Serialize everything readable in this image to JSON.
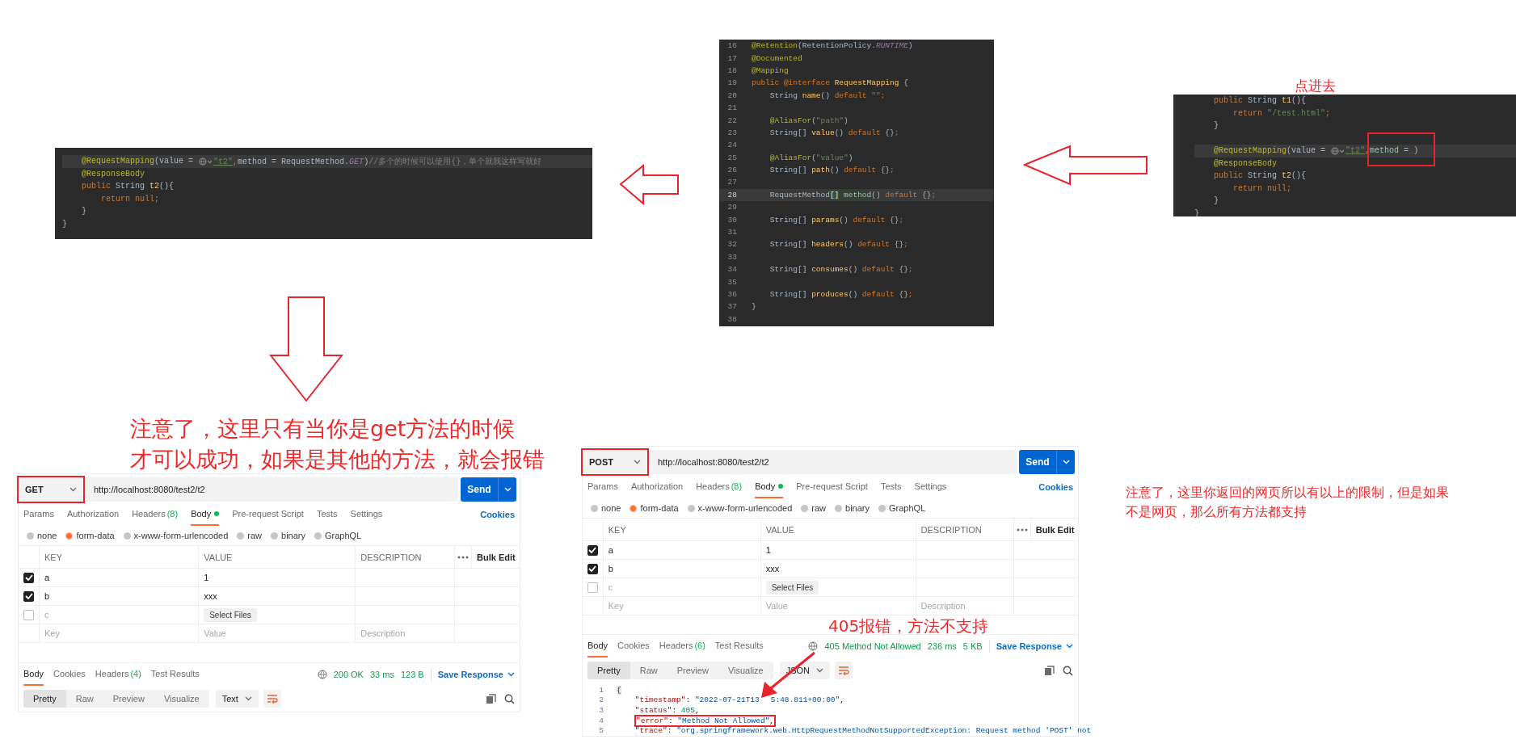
{
  "annotations": [
    {
      "text": "点进去"
    },
    {
      "text": "注意了，这里只有当你是get方法的时候"
    },
    {
      "text": "才可以成功，如果是其他的方法，就会报错"
    },
    {
      "text": "405报错，方法不支持"
    },
    {
      "text": "注意了，这里你返回的网页所以有以上的限制，但是如果"
    },
    {
      "text": "不是网页，那么所有方法都支持"
    }
  ],
  "code_snippets": [
    {
      "lines": [
        {
          "current": true,
          "tokens": [
            {
              "t": "    @RequestMapping",
              "kind": "ann"
            },
            {
              "t": "(value = ",
              "kind": "p"
            },
            {
              "kind": "inlay"
            },
            {
              "t": "\"t2\"",
              "kind": "link"
            },
            {
              "t": ",",
              "kind": "kw"
            },
            {
              "t": "method = RequestMethod.",
              "kind": "p"
            },
            {
              "t": "GET",
              "kind": "const"
            },
            {
              "t": ")",
              "kind": "p"
            },
            {
              "t": "//多个的时候可以使用{}，单个就我这样写就好",
              "kind": "comment"
            }
          ]
        },
        {
          "current": false,
          "tokens": [
            {
              "t": "    @ResponseBody",
              "kind": "ann"
            }
          ]
        },
        {
          "current": false,
          "tokens": [
            {
              "t": "    public ",
              "kind": "kw"
            },
            {
              "t": "String ",
              "kind": "p"
            },
            {
              "t": "t2",
              "kind": "fn"
            },
            {
              "t": "(){",
              "kind": "p"
            }
          ]
        },
        {
          "current": false,
          "tokens": [
            {
              "t": "        return null;",
              "kind": "kw"
            }
          ]
        },
        {
          "current": false,
          "tokens": [
            {
              "t": "    }",
              "kind": "p"
            }
          ]
        },
        {
          "current": false,
          "tokens": [
            {
              "t": "}",
              "kind": "p"
            }
          ]
        }
      ]
    },
    {
      "lines": [
        {
          "num": "16",
          "current": false,
          "tokens": [
            {
              "t": "@Retention",
              "kind": "ann"
            },
            {
              "t": "(RetentionPolicy.",
              "kind": "p"
            },
            {
              "t": "RUNTIME",
              "kind": "const"
            },
            {
              "t": ")",
              "kind": "p"
            }
          ]
        },
        {
          "num": "17",
          "current": false,
          "tokens": [
            {
              "t": "@Documented",
              "kind": "ann"
            }
          ]
        },
        {
          "num": "18",
          "current": false,
          "tokens": [
            {
              "t": "@Mapping",
              "kind": "ann"
            }
          ]
        },
        {
          "num": "19",
          "current": false,
          "tokens": [
            {
              "t": "public @interface ",
              "kind": "kw"
            },
            {
              "t": "RequestMapping ",
              "kind": "fn"
            },
            {
              "t": "{",
              "kind": "p"
            }
          ]
        },
        {
          "num": "20",
          "current": false,
          "tokens": [
            {
              "t": "    String ",
              "kind": "p"
            },
            {
              "t": "name",
              "kind": "fn"
            },
            {
              "t": "() ",
              "kind": "p"
            },
            {
              "t": "default ",
              "kind": "kw"
            },
            {
              "t": "\"\"",
              "kind": "str"
            },
            {
              "t": ";",
              "kind": "kw"
            }
          ]
        },
        {
          "num": "21",
          "current": false
        },
        {
          "num": "22",
          "current": false,
          "tokens": [
            {
              "t": "    @AliasFor",
              "kind": "ann"
            },
            {
              "t": "(",
              "kind": "p"
            },
            {
              "t": "\"path\"",
              "kind": "str"
            },
            {
              "t": ")",
              "kind": "p"
            }
          ]
        },
        {
          "num": "23",
          "current": false,
          "tokens": [
            {
              "t": "    String[] ",
              "kind": "p"
            },
            {
              "t": "value",
              "kind": "fn"
            },
            {
              "t": "() ",
              "kind": "p"
            },
            {
              "t": "default ",
              "kind": "kw"
            },
            {
              "t": "{}",
              "kind": "p"
            },
            {
              "t": ";",
              "kind": "kw"
            }
          ]
        },
        {
          "num": "24",
          "current": false
        },
        {
          "num": "25",
          "current": false,
          "tokens": [
            {
              "t": "    @AliasFor",
              "kind": "ann"
            },
            {
              "t": "(",
              "kind": "p"
            },
            {
              "t": "\"value\"",
              "kind": "str"
            },
            {
              "t": ")",
              "kind": "p"
            }
          ]
        },
        {
          "num": "26",
          "current": false,
          "tokens": [
            {
              "t": "    String[] ",
              "kind": "p"
            },
            {
              "t": "path",
              "kind": "fn"
            },
            {
              "t": "() ",
              "kind": "p"
            },
            {
              "t": "default ",
              "kind": "kw"
            },
            {
              "t": "{}",
              "kind": "p"
            },
            {
              "t": ";",
              "kind": "kw"
            }
          ]
        },
        {
          "num": "27",
          "current": false
        },
        {
          "num": "28",
          "current": true,
          "tokens": [
            {
              "t": "    RequestMethod",
              "kind": "p"
            },
            {
              "t": "[]",
              "kind": "match"
            },
            {
              "t": " method",
              "kind": "usage"
            },
            {
              "t": "() ",
              "kind": "p"
            },
            {
              "t": "default ",
              "kind": "kw"
            },
            {
              "t": "{}",
              "kind": "p"
            },
            {
              "t": ";",
              "kind": "kw"
            }
          ]
        },
        {
          "num": "29",
          "current": false
        },
        {
          "num": "30",
          "current": false,
          "tokens": [
            {
              "t": "    String[] ",
              "kind": "p"
            },
            {
              "t": "params",
              "kind": "fn"
            },
            {
              "t": "() ",
              "kind": "p"
            },
            {
              "t": "default ",
              "kind": "kw"
            },
            {
              "t": "{}",
              "kind": "p"
            },
            {
              "t": ";",
              "kind": "kw"
            }
          ]
        },
        {
          "num": "31",
          "current": false
        },
        {
          "num": "32",
          "current": false,
          "tokens": [
            {
              "t": "    String[] ",
              "kind": "p"
            },
            {
              "t": "headers",
              "kind": "fn"
            },
            {
              "t": "() ",
              "kind": "p"
            },
            {
              "t": "default ",
              "kind": "kw"
            },
            {
              "t": "{}",
              "kind": "p"
            },
            {
              "t": ";",
              "kind": "kw"
            }
          ]
        },
        {
          "num": "33",
          "current": false
        },
        {
          "num": "34",
          "current": false,
          "tokens": [
            {
              "t": "    String[] ",
              "kind": "p"
            },
            {
              "t": "consumes",
              "kind": "fn"
            },
            {
              "t": "() ",
              "kind": "p"
            },
            {
              "t": "default ",
              "kind": "kw"
            },
            {
              "t": "{}",
              "kind": "p"
            },
            {
              "t": ";",
              "kind": "kw"
            }
          ]
        },
        {
          "num": "35",
          "current": false
        },
        {
          "num": "36",
          "current": false,
          "tokens": [
            {
              "t": "    String[] ",
              "kind": "p"
            },
            {
              "t": "produces",
              "kind": "fn"
            },
            {
              "t": "() ",
              "kind": "p"
            },
            {
              "t": "default ",
              "kind": "kw"
            },
            {
              "t": "{}",
              "kind": "p"
            },
            {
              "t": ";",
              "kind": "kw"
            }
          ]
        },
        {
          "num": "37",
          "current": false,
          "tokens": [
            {
              "t": "}",
              "kind": "p"
            }
          ]
        },
        {
          "num": "38",
          "current": false
        }
      ]
    },
    {
      "callout": true,
      "lines": [
        {
          "current": false,
          "tokens": [
            {
              "t": "    public ",
              "kind": "kw"
            },
            {
              "t": "String ",
              "kind": "p"
            },
            {
              "t": "t1",
              "kind": "fn"
            },
            {
              "t": "(){",
              "kind": "p"
            }
          ]
        },
        {
          "current": false,
          "tokens": [
            {
              "t": "        return ",
              "kind": "kw"
            },
            {
              "t": "\"/test.html\"",
              "kind": "str"
            },
            {
              "t": ";",
              "kind": "kw"
            }
          ]
        },
        {
          "current": false,
          "tokens": [
            {
              "t": "    }",
              "kind": "p"
            }
          ]
        },
        {
          "current": false
        },
        {
          "current": true,
          "tokens": [
            {
              "t": "    @RequestMapping",
              "kind": "ann"
            },
            {
              "t": "(value = ",
              "kind": "p"
            },
            {
              "kind": "inlay"
            },
            {
              "t": "\"t2\"",
              "kind": "link"
            },
            {
              "t": ",",
              "kind": "kw"
            },
            {
              "t": "method",
              "kind": "usage"
            },
            {
              "t": " =",
              "kind": "p"
            },
            {
              "t": "_",
              "kind": "err"
            },
            {
              "t": ")",
              "kind": "p"
            }
          ]
        },
        {
          "current": false,
          "tokens": [
            {
              "t": "    @ResponseBody",
              "kind": "ann"
            }
          ]
        },
        {
          "current": false,
          "tokens": [
            {
              "t": "    public ",
              "kind": "kw"
            },
            {
              "t": "String ",
              "kind": "p"
            },
            {
              "t": "t2",
              "kind": "fn"
            },
            {
              "t": "(){",
              "kind": "p"
            }
          ]
        },
        {
          "current": false,
          "tokens": [
            {
              "t": "        return null;",
              "kind": "kw"
            }
          ]
        },
        {
          "current": false,
          "tokens": [
            {
              "t": "    }",
              "kind": "p"
            }
          ]
        },
        {
          "current": false,
          "tokens": [
            {
              "t": "}",
              "kind": "p"
            }
          ]
        }
      ]
    }
  ],
  "requests": [
    {
      "method": "GET",
      "method_boxed": true,
      "url": "http://localhost:8080/test2/t2",
      "send": "Send",
      "tabs": [
        {
          "label": "Params",
          "selected": false
        },
        {
          "label": "Authorization",
          "selected": false
        },
        {
          "label": "Headers",
          "count": "(8)",
          "selected": false
        },
        {
          "label": "Body",
          "dot": true,
          "selected": true
        },
        {
          "label": "Pre-request Script",
          "selected": false
        },
        {
          "label": "Tests",
          "selected": false
        },
        {
          "label": "Settings",
          "selected": false
        }
      ],
      "cookies": "Cookies",
      "body_types": [
        {
          "label": "none",
          "selected": false
        },
        {
          "label": "form-data",
          "selected": true
        },
        {
          "label": "x-www-form-urlencoded",
          "selected": false
        },
        {
          "label": "raw",
          "selected": false
        },
        {
          "label": "binary",
          "selected": false
        },
        {
          "label": "GraphQL",
          "selected": false
        }
      ],
      "columns": [
        "KEY",
        "VALUE",
        "DESCRIPTION"
      ],
      "bulk_edit": "Bulk Edit",
      "rows": [
        {
          "checked": true,
          "key": "a",
          "value": "1"
        },
        {
          "checked": true,
          "key": "b",
          "value": "xxx"
        },
        {
          "checked": false,
          "key": "c",
          "file_button": "Select Files"
        }
      ],
      "new_row": {
        "key": {
          "placeholder": "Key"
        },
        "value": {
          "placeholder": "Value"
        },
        "description": {
          "placeholder": "Description"
        }
      },
      "response_tabs": [
        {
          "label": "Body",
          "selected": true
        },
        {
          "label": "Cookies",
          "selected": false
        },
        {
          "label": "Headers",
          "count": "(4)",
          "selected": false
        },
        {
          "label": "Test Results",
          "selected": false
        }
      ],
      "status": "200 OK",
      "time": "33 ms",
      "size": "123 B",
      "save_response": "Save Response",
      "views": [
        {
          "label": "Pretty",
          "selected": true
        },
        {
          "label": "Raw",
          "selected": false
        },
        {
          "label": "Preview",
          "selected": false
        },
        {
          "label": "Visualize",
          "selected": false
        }
      ],
      "format": "Text"
    },
    {
      "method": "POST",
      "method_boxed": true,
      "url": "http://localhost:8080/test2/t2",
      "send": "Send",
      "tabs": [
        {
          "label": "Params",
          "selected": false
        },
        {
          "label": "Authorization",
          "selected": false
        },
        {
          "label": "Headers",
          "count": "(8)",
          "selected": false
        },
        {
          "label": "Body",
          "dot": true,
          "selected": true
        },
        {
          "label": "Pre-request Script",
          "selected": false
        },
        {
          "label": "Tests",
          "selected": false
        },
        {
          "label": "Settings",
          "selected": false
        }
      ],
      "cookies": "Cookies",
      "body_types": [
        {
          "label": "none",
          "selected": false
        },
        {
          "label": "form-data",
          "selected": true
        },
        {
          "label": "x-www-form-urlencoded",
          "selected": false
        },
        {
          "label": "raw",
          "selected": false
        },
        {
          "label": "binary",
          "selected": false
        },
        {
          "label": "GraphQL",
          "selected": false
        }
      ],
      "columns": [
        "KEY",
        "VALUE",
        "DESCRIPTION"
      ],
      "bulk_edit": "Bulk Edit",
      "rows": [
        {
          "checked": true,
          "key": "a",
          "value": "1"
        },
        {
          "checked": true,
          "key": "b",
          "value": "xxx"
        },
        {
          "checked": false,
          "key": "c",
          "file_button": "Select Files"
        }
      ],
      "new_row": {
        "key": {
          "placeholder": "Key"
        },
        "value": {
          "placeholder": "Value"
        },
        "description": {
          "placeholder": "Description"
        }
      },
      "response_tabs": [
        {
          "label": "Body",
          "selected": true
        },
        {
          "label": "Cookies",
          "selected": false
        },
        {
          "label": "Headers",
          "count": "(6)",
          "selected": false
        },
        {
          "label": "Test Results",
          "selected": false
        }
      ],
      "status": "405 Method Not Allowed",
      "time": "236 ms",
      "size": "5 KB",
      "save_response": "Save Response",
      "views": [
        {
          "label": "Pretty",
          "selected": true
        },
        {
          "label": "Raw",
          "selected": false
        },
        {
          "label": "Preview",
          "selected": false
        },
        {
          "label": "Visualize",
          "selected": false
        }
      ],
      "format": "JSON",
      "body_lines": [
        {
          "num": "1",
          "boxed": false,
          "tokens": [
            {
              "t": "{",
              "kind": "brace"
            }
          ]
        },
        {
          "num": "2",
          "boxed": false,
          "tokens": [
            {
              "t": "    \"timestamp\"",
              "kind": "key"
            },
            {
              "t": ": ",
              "kind": "punct"
            },
            {
              "t": "\"2022-07-21T13",
              "kind": "str"
            },
            {
              "t": "5:48.811+00:00\"",
              "kind": "str_after_gap"
            },
            {
              "t": ",",
              "kind": "punct"
            }
          ]
        },
        {
          "num": "3",
          "boxed": false,
          "tokens": [
            {
              "t": "    \"status\"",
              "kind": "key"
            },
            {
              "t": ": ",
              "kind": "punct"
            },
            {
              "t": "405",
              "kind": "num"
            },
            {
              "t": ",",
              "kind": "punct"
            }
          ]
        },
        {
          "num": "4",
          "boxed": true,
          "tokens": [
            {
              "t": "\"error\"",
              "kind": "key"
            },
            {
              "t": ": ",
              "kind": "punct"
            },
            {
              "t": "\"Method Not Allowed\"",
              "kind": "str"
            },
            {
              "t": ",",
              "kind": "punct"
            }
          ]
        },
        {
          "num": "5",
          "boxed": false,
          "tokens": [
            {
              "t": "    \"trace\"",
              "kind": "key"
            },
            {
              "t": ": ",
              "kind": "punct"
            },
            {
              "t": "\"org.springframework.web.HttpRequestMethodNotSupportedException: Request method 'POST' not",
              "kind": "str"
            }
          ]
        }
      ]
    }
  ]
}
